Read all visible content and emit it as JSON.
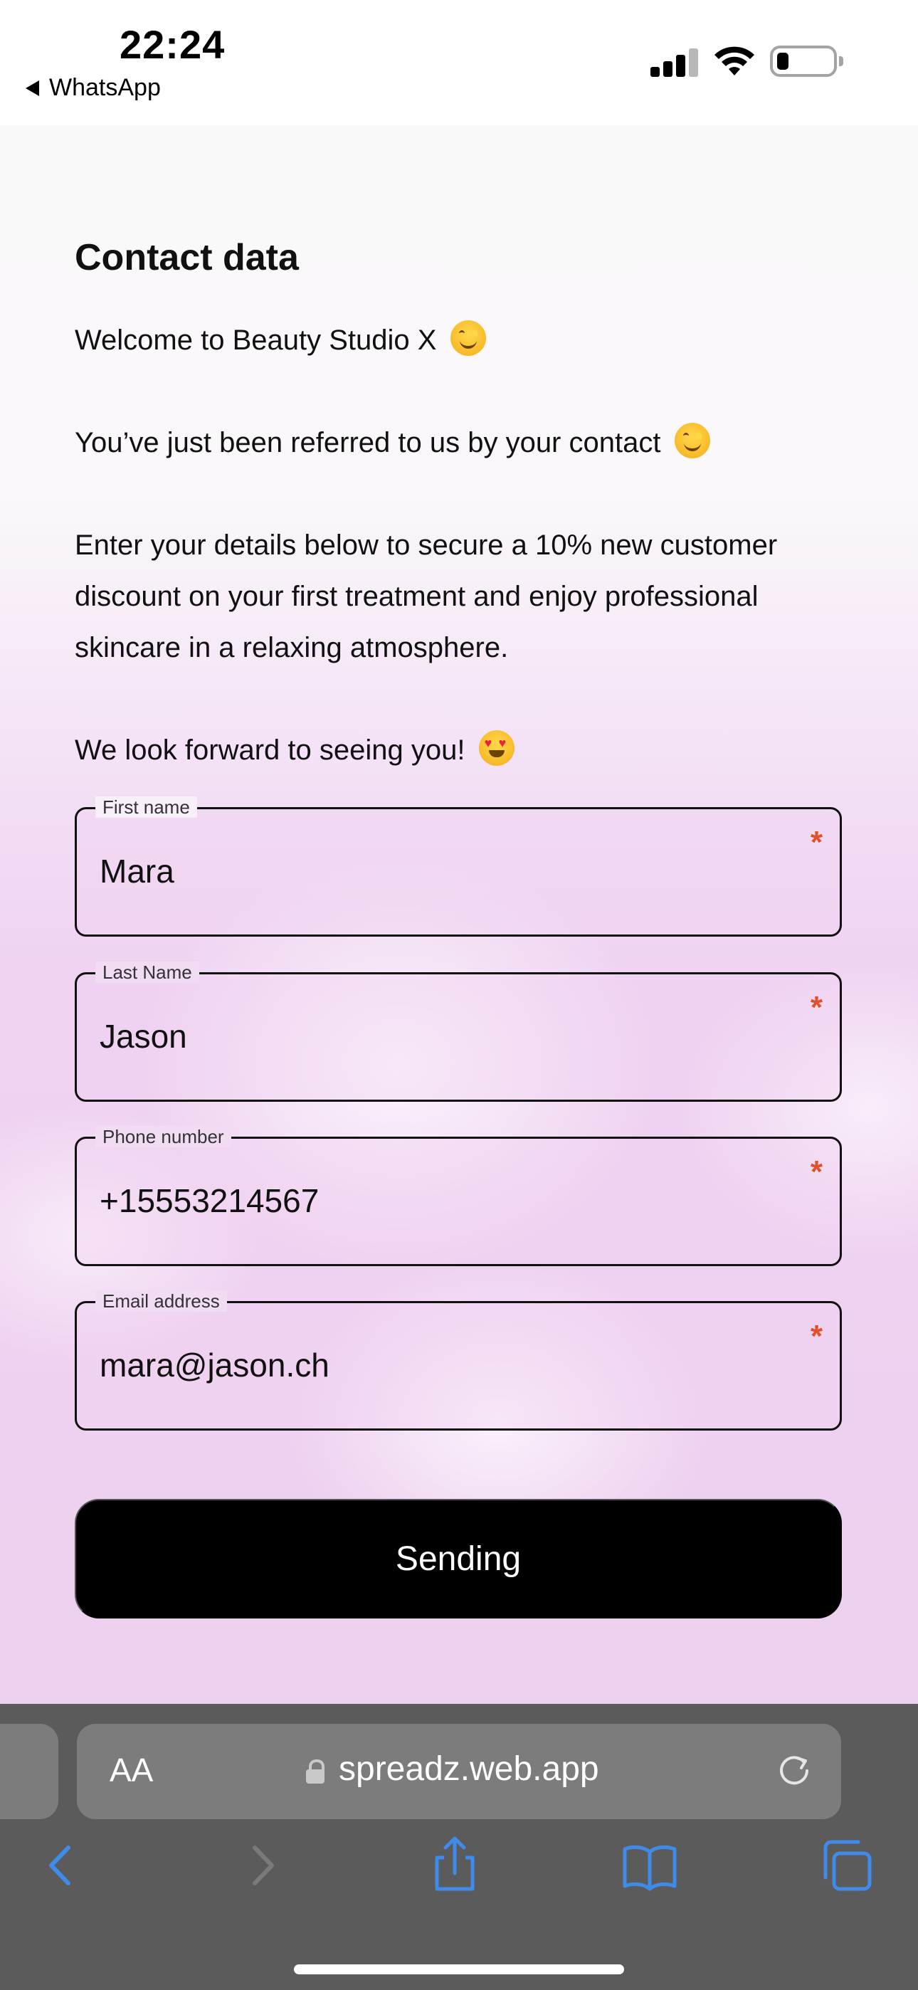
{
  "status_bar": {
    "time": "22:24",
    "back_app": "WhatsApp",
    "icons": [
      "cellular-signal-icon",
      "wifi-icon",
      "battery-icon"
    ]
  },
  "page": {
    "heading": "Contact data",
    "paragraphs": {
      "welcome": "Welcome to Beauty Studio X",
      "referred": "You’ve just been referred to us by your contact",
      "details": "Enter your details below to secure a 10% new customer discount on your first treatment and enjoy professional skincare in a relaxing atmosphere.",
      "forward": "We look forward to seeing you!"
    },
    "emojis": [
      "smiling-face-emoji",
      "smiling-face-emoji",
      "heart-eyes-emoji"
    ]
  },
  "form": {
    "first_name": {
      "label": "First name",
      "value": "Mara",
      "required_mark": "*"
    },
    "last_name": {
      "label": "Last Name",
      "value": "Jason",
      "required_mark": "*"
    },
    "phone": {
      "label": "Phone number",
      "value": "+15553214567",
      "required_mark": "*"
    },
    "email": {
      "label": "Email address",
      "value": "mara@jason.ch",
      "required_mark": "*"
    },
    "submit_label": "Sending"
  },
  "safari": {
    "aa_label": "AA",
    "url": "spreadz.web.app",
    "toolbar_icons": [
      "back-icon",
      "forward-icon",
      "share-icon",
      "bookmarks-icon",
      "tabs-icon"
    ]
  },
  "colors": {
    "accent_required": "#e2502a",
    "safari_icon": "#3f8bea",
    "background_pink": "#efd2f1",
    "button": "#000000"
  }
}
